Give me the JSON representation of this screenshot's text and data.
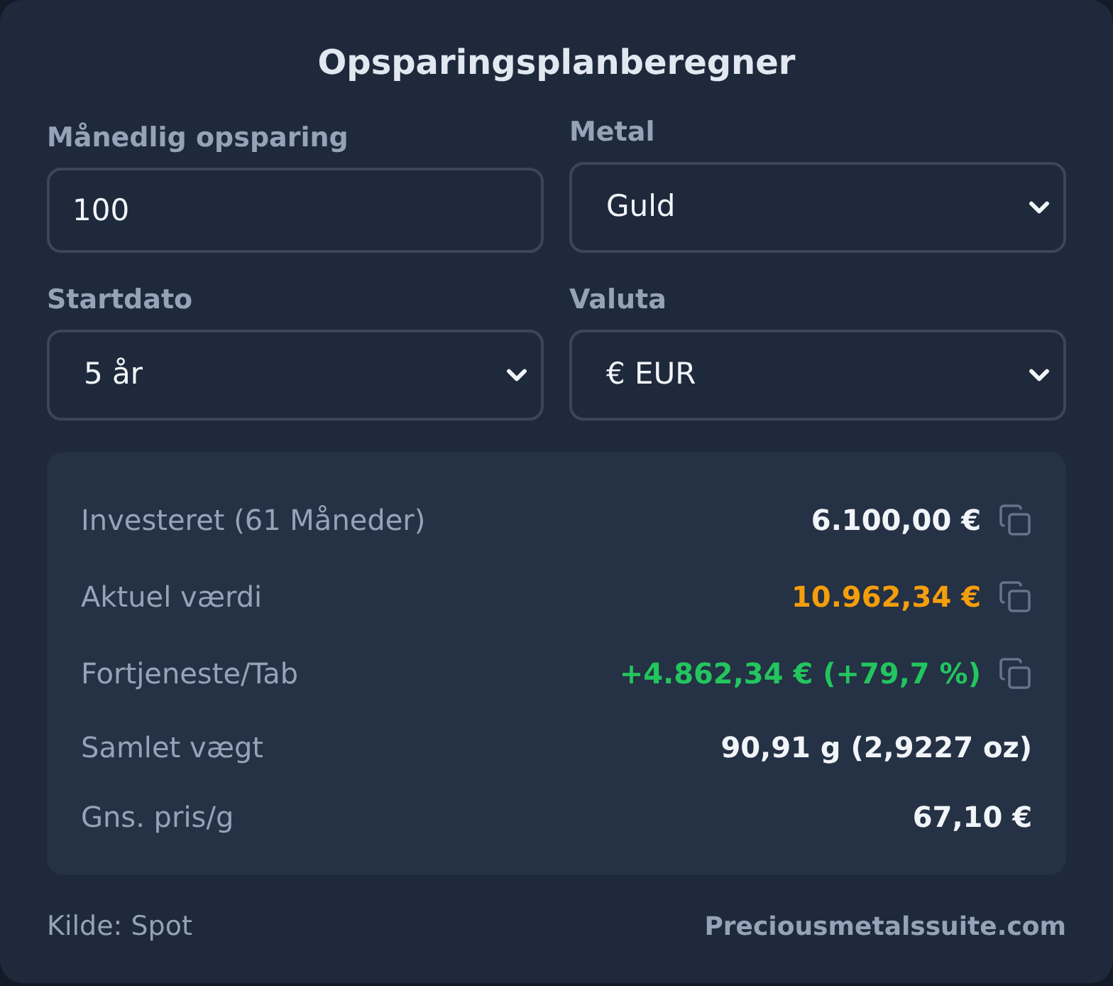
{
  "title": "Opsparingsplanberegner",
  "fields": [
    {
      "kind": "input",
      "label": "Månedlig opsparing",
      "value": "100"
    },
    {
      "kind": "select",
      "label": "Metal",
      "value": "Guld"
    },
    {
      "kind": "select",
      "label": "Startdato",
      "value": "5 år"
    },
    {
      "kind": "select",
      "label": "Valuta",
      "value": "€ EUR"
    }
  ],
  "results": [
    {
      "label": "Investeret (61 Måneder)",
      "value": "6.100,00 €",
      "color": "#f1f5f9",
      "copyable": true
    },
    {
      "label": "Aktuel værdi",
      "value": "10.962,34 €",
      "color": "#f59e0b",
      "copyable": true
    },
    {
      "label": "Fortjeneste/Tab",
      "value": "+4.862,34 € (+79,7 %)",
      "color": "#22c55e",
      "copyable": true
    },
    {
      "label": "Samlet vægt",
      "value": "90,91 g (2,9227 oz)",
      "color": "#f1f5f9",
      "copyable": false
    },
    {
      "label": "Gns. pris/g",
      "value": "67,10 €",
      "color": "#f1f5f9",
      "copyable": false
    }
  ],
  "footer": {
    "source": "Kilde: Spot",
    "link": "Preciousmetalssuite.com"
  }
}
